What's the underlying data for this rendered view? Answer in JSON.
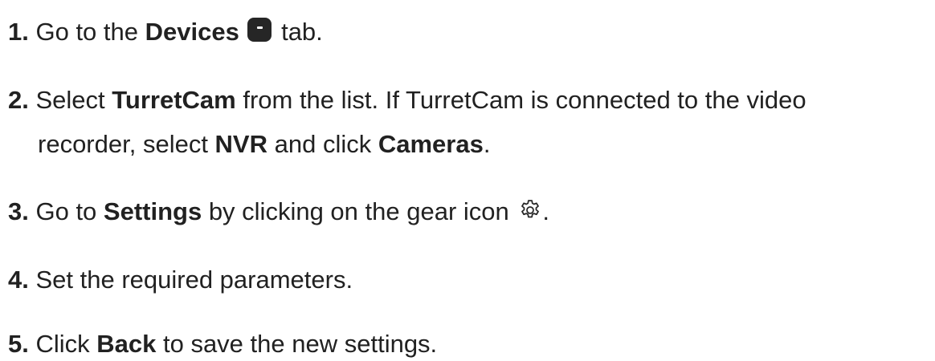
{
  "steps": [
    {
      "num": "1.",
      "t1": " Go to the ",
      "b1": "Devices",
      "icon": "device-icon",
      "t2": " tab."
    },
    {
      "num": "2.",
      "t1": " Select ",
      "b1": "TurretCam",
      "t2": " from the list. If TurretCam is connected to the video",
      "t3": "recorder, select ",
      "b2": "NVR",
      "t4": " and click ",
      "b3": "Cameras",
      "t5": "."
    },
    {
      "num": "3.",
      "t1": " Go to ",
      "b1": "Settings",
      "t2": " by clicking on the gear icon ",
      "icon": "gear-icon",
      "t3": "."
    },
    {
      "num": "4.",
      "t1": " Set the required parameters."
    },
    {
      "num": "5.",
      "t1": " Click ",
      "b1": "Back",
      "t2": " to save the new settings."
    }
  ],
  "colors": {
    "text": "#212121",
    "icon": "#262626"
  }
}
